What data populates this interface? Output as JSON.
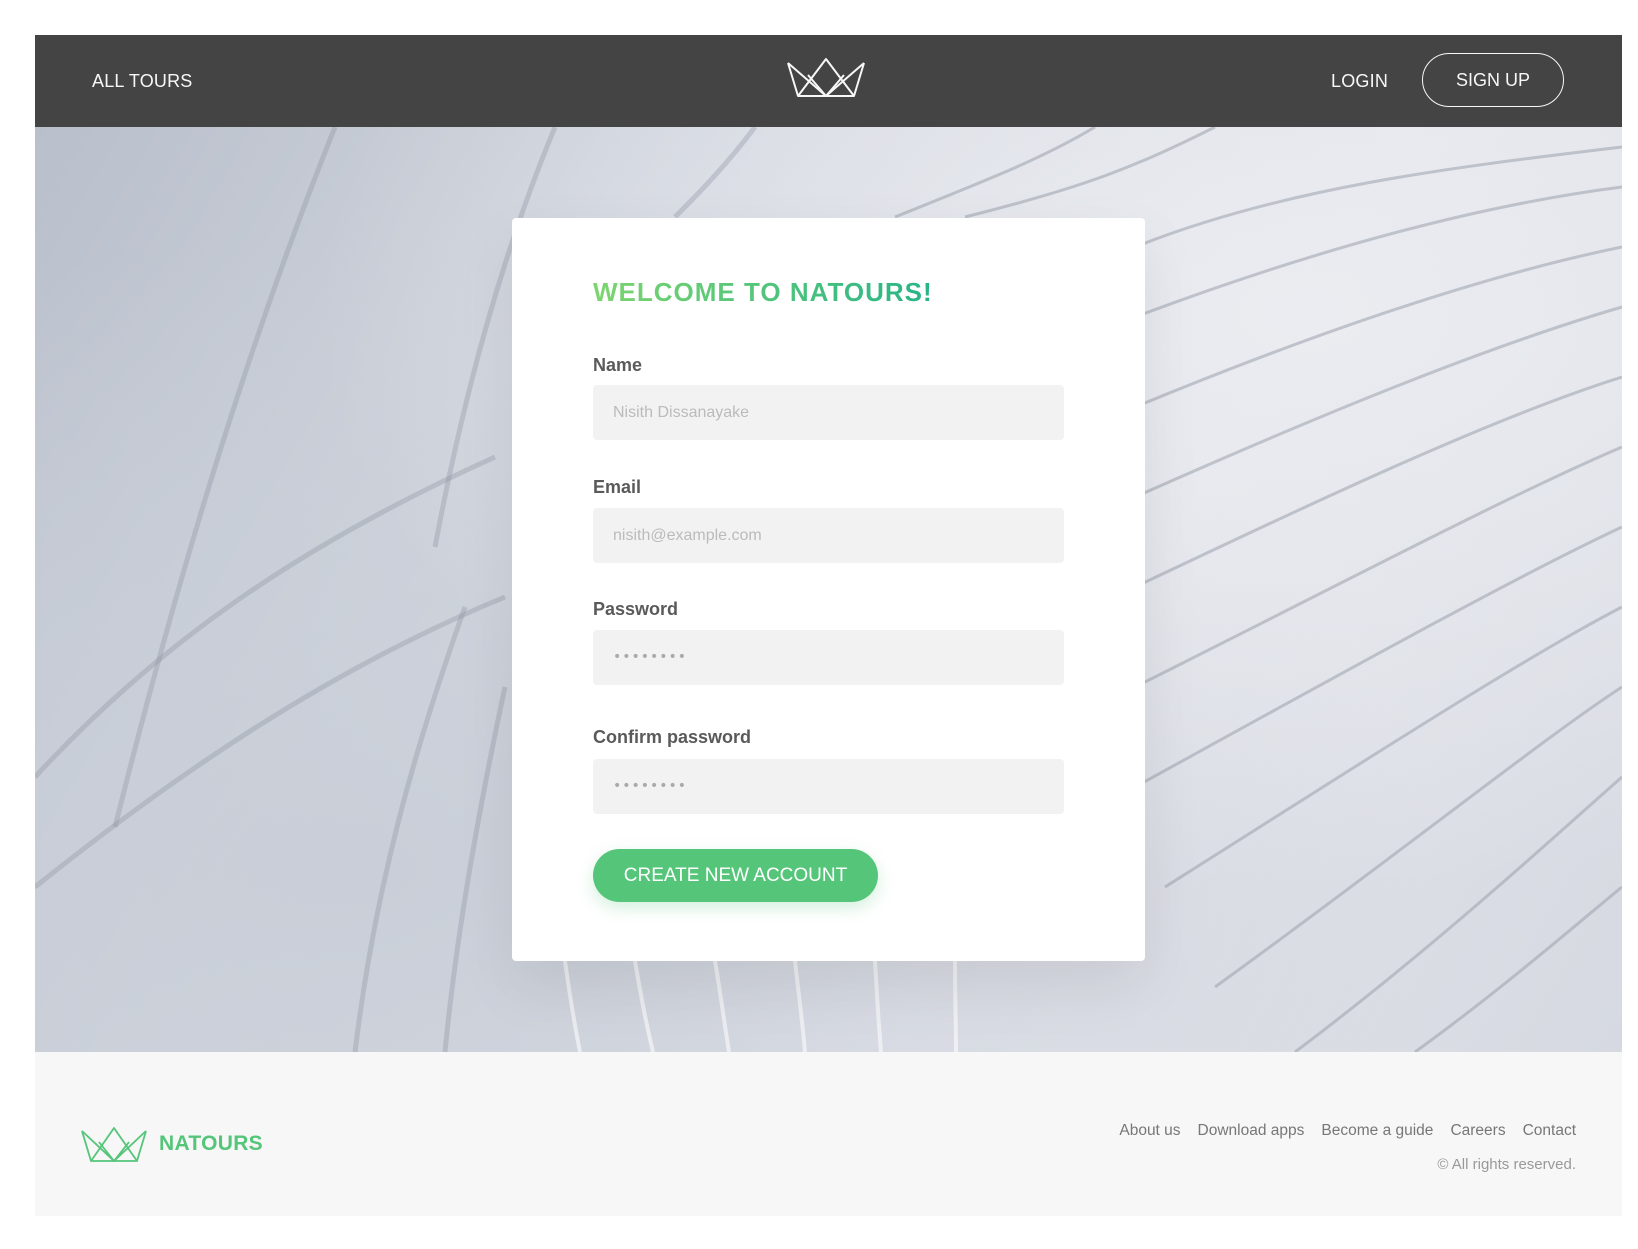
{
  "header": {
    "all_tours": "ALL TOURS",
    "login": "LOGIN",
    "signup": "SIGN UP",
    "logo_icon": "crown-logo-icon"
  },
  "form": {
    "title": "WELCOME TO NATOURS!",
    "name_label": "Name",
    "name_placeholder": "Nisith Dissanayake",
    "email_label": "Email",
    "email_placeholder": "nisith@example.com",
    "password_label": "Password",
    "password_value": "••••••••",
    "confirm_label": "Confirm password",
    "confirm_value": "••••••••",
    "submit": "CREATE NEW ACCOUNT"
  },
  "footer": {
    "brand": "NATOURS",
    "links": [
      "About us",
      "Download apps",
      "Become a guide",
      "Careers",
      "Contact"
    ],
    "copyright": "© All rights reserved."
  },
  "colors": {
    "accent": "#55c57a",
    "header_bg": "#444444",
    "footer_bg": "#f7f7f7",
    "input_bg": "#f2f2f2"
  }
}
